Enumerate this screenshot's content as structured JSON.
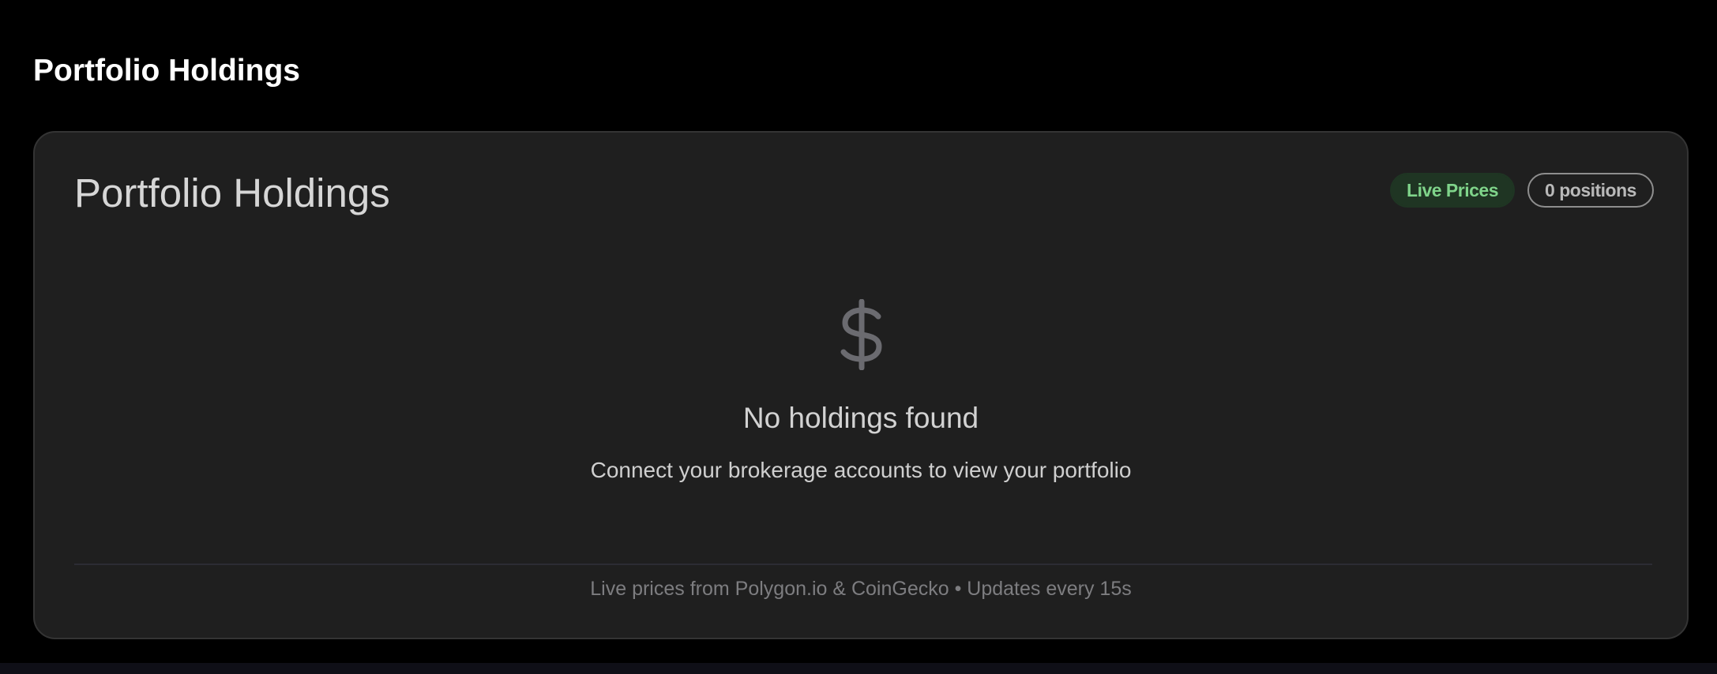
{
  "header": {
    "title": "Portfolio Holdings"
  },
  "card": {
    "title": "Portfolio Holdings",
    "badges": {
      "live": "Live Prices",
      "positions": "0 positions"
    },
    "empty_state": {
      "icon": "dollar-icon",
      "title": "No holdings found",
      "subtitle": "Connect your brokerage accounts to view your portfolio"
    },
    "footer": "Live prices from Polygon.io & CoinGecko • Updates every 15s"
  },
  "colors": {
    "page_background": "#000000",
    "card_background": "#1f1f1f",
    "live_badge_background": "#1f3523",
    "live_badge_text": "#7fd48a",
    "icon": "#6b6b70"
  }
}
